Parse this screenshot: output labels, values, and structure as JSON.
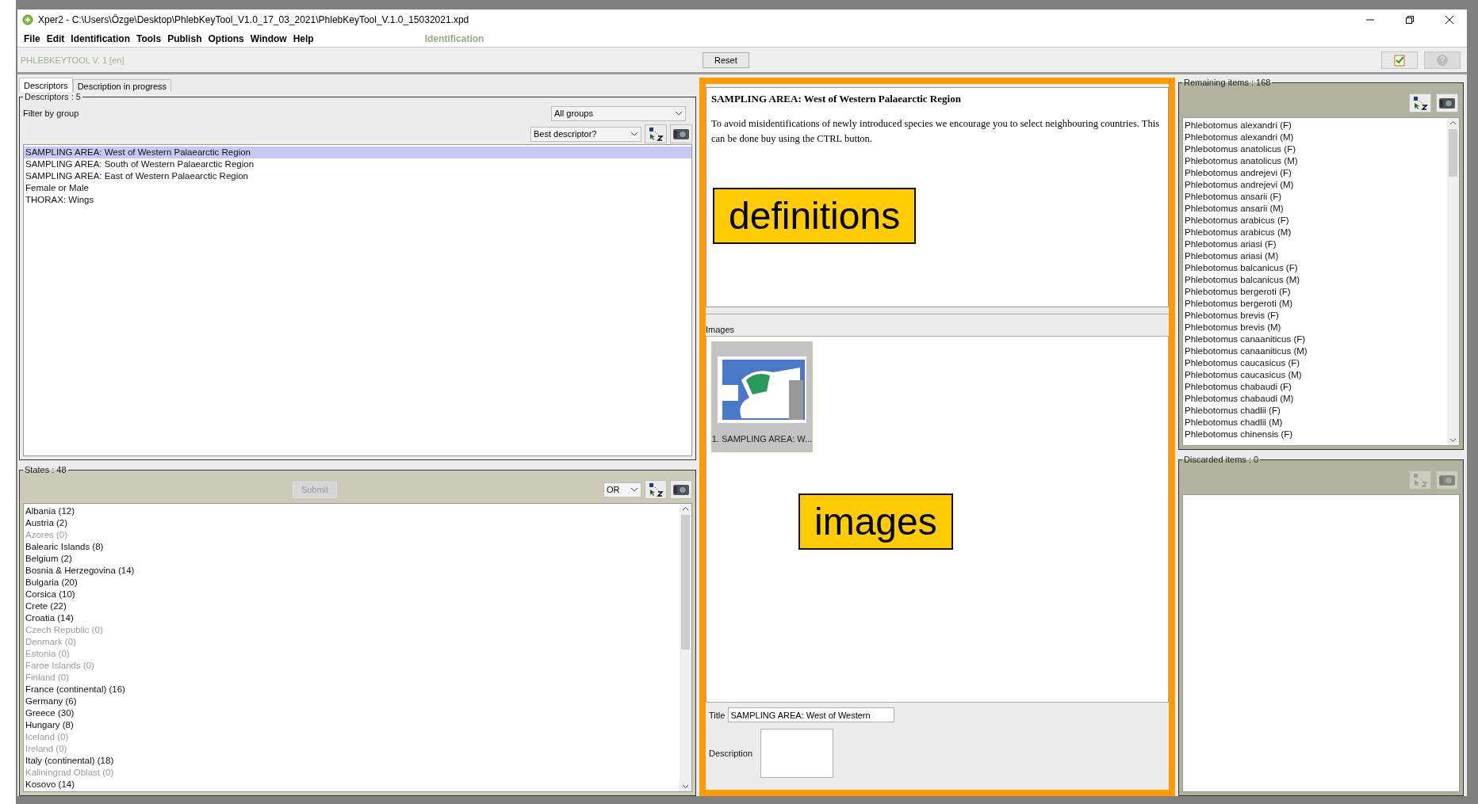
{
  "window": {
    "title": "Xper2 - C:\\Users\\Özge\\Desktop\\PhlebKeyTool_V1.0_17_03_2021\\PhlebKeyTool_V.1.0_15032021.xpd"
  },
  "menu": [
    "File",
    "Edit",
    "Identification",
    "Tools",
    "Publish",
    "Options",
    "Window",
    "Help"
  ],
  "perspective": "Identification",
  "toolbar": {
    "project": "PHLEBKEYTOOL V. 1 [en]",
    "reset": "Reset"
  },
  "tabs": [
    {
      "label": "Descriptors",
      "selected": true
    },
    {
      "label": "Description in progress",
      "selected": false
    }
  ],
  "descriptors": {
    "legend": "Descriptors : 5",
    "filter_label": "Filter by group",
    "filter_value": "All groups",
    "sort_value": "Best descriptor?",
    "items": [
      {
        "label": "SAMPLING AREA: West of Western Palaearctic Region",
        "selected": true
      },
      {
        "label": "SAMPLING AREA: South of Western Palaearctic Region",
        "selected": false
      },
      {
        "label": "SAMPLING AREA: East of Western Palaearctic Region",
        "selected": false
      },
      {
        "label": "Female or Male",
        "selected": false
      },
      {
        "label": "THORAX: Wings",
        "selected": false
      }
    ]
  },
  "states": {
    "legend": "States : 48",
    "submit": "Submit",
    "submit_disabled": true,
    "operator": "OR",
    "items": [
      {
        "label": "Albania (12)",
        "available": true
      },
      {
        "label": "Austria (2)",
        "available": true
      },
      {
        "label": "Azores (0)",
        "available": false
      },
      {
        "label": "Balearic Islands (8)",
        "available": true
      },
      {
        "label": "Belgium (2)",
        "available": true
      },
      {
        "label": "Bosnia & Herzegovina (14)",
        "available": true
      },
      {
        "label": "Bulgaria (20)",
        "available": true
      },
      {
        "label": "Corsica (10)",
        "available": true
      },
      {
        "label": "Crete (22)",
        "available": true
      },
      {
        "label": "Croatia (14)",
        "available": true
      },
      {
        "label": "Czech Republic (0)",
        "available": false
      },
      {
        "label": "Denmark (0)",
        "available": false
      },
      {
        "label": "Estonia (0)",
        "available": false
      },
      {
        "label": "Faroe Islands (0)",
        "available": false
      },
      {
        "label": "Finland (0)",
        "available": false
      },
      {
        "label": "France (continental) (16)",
        "available": true
      },
      {
        "label": "Germany (6)",
        "available": true
      },
      {
        "label": "Greece (30)",
        "available": true
      },
      {
        "label": "Hungary (8)",
        "available": true
      },
      {
        "label": "Iceland (0)",
        "available": false
      },
      {
        "label": "Ireland (0)",
        "available": false
      },
      {
        "label": "Italy (continental) (18)",
        "available": true
      },
      {
        "label": "Kaliningrad Oblast (0)",
        "available": false
      },
      {
        "label": "Kosovo (14)",
        "available": true
      }
    ]
  },
  "definition": {
    "title": "SAMPLING AREA: West of Western Palaearctic Region",
    "text": "To avoid misidentifications of newly introduced species we encourage you to select neighbouring countries. This can be done buy using the CTRL button.",
    "callout": "definitions"
  },
  "images": {
    "legend": "Images",
    "thumbnails": [
      {
        "caption": "1. SAMPLING AREA: W..."
      }
    ],
    "callout": "images",
    "title_label": "Title",
    "title_value": "SAMPLING AREA: West of Western",
    "description_label": "Description"
  },
  "remaining": {
    "legend": "Remaining items : 168",
    "items": [
      "Phlebotomus alexandri (F)",
      "Phlebotomus alexandri (M)",
      "Phlebotomus anatolicus (F)",
      "Phlebotomus anatolicus (M)",
      "Phlebotomus andrejevi (F)",
      "Phlebotomus andrejevi (M)",
      "Phlebotomus ansarii (F)",
      "Phlebotomus ansarii (M)",
      "Phlebotomus arabicus (F)",
      "Phlebotomus arabicus (M)",
      "Phlebotomus ariasi (F)",
      "Phlebotomus ariasi (M)",
      "Phlebotomus balcanicus (F)",
      "Phlebotomus balcanicus (M)",
      "Phlebotomus bergeroti (F)",
      "Phlebotomus bergeroti (M)",
      "Phlebotomus brevis (F)",
      "Phlebotomus brevis (M)",
      "Phlebotomus canaaniticus (F)",
      "Phlebotomus canaaniticus (M)",
      "Phlebotomus caucasicus (F)",
      "Phlebotomus caucasicus (M)",
      "Phlebotomus chabaudi (F)",
      "Phlebotomus chabaudi (M)",
      "Phlebotomus chadlii (F)",
      "Phlebotomus chadlii (M)",
      "Phlebotomus chinensis (F)"
    ]
  },
  "discarded": {
    "legend": "Discarded items : 0",
    "tools_disabled": true
  }
}
